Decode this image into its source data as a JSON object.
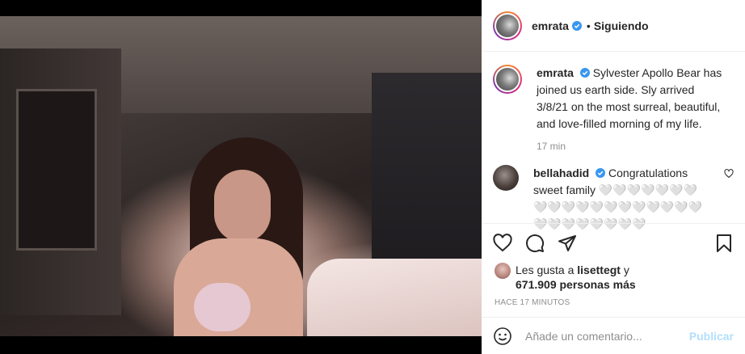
{
  "post": {
    "author": "emrata",
    "header_separator": "•",
    "follow_status": "Siguiendo"
  },
  "caption": {
    "username": "emrata",
    "text": "Sylvester Apollo Bear has joined us earth side. Sly arrived 3/8/21 on the most surreal, beautiful, and love-filled morning of my life.",
    "time": "17 min"
  },
  "comment": {
    "username": "bellahadid",
    "text": "Congratulations sweet family 🤍🤍🤍🤍🤍🤍🤍🤍🤍🤍🤍🤍🤍🤍🤍🤍🤍🤍🤍🤍🤍🤍🤍🤍🤍🤍🤍"
  },
  "likes": {
    "prefix": "Les gusta a",
    "user": "lisettegt",
    "connector": "y",
    "count": "671.909 personas más"
  },
  "posted_ago": "HACE 17 MINUTOS",
  "add_comment": {
    "placeholder": "Añade un comentario...",
    "publish_label": "Publicar"
  },
  "icons": {
    "verified": "verified-badge-icon",
    "like": "heart-icon",
    "comment": "comment-bubble-icon",
    "share": "paper-plane-icon",
    "save": "bookmark-icon",
    "emoji": "smiley-icon"
  },
  "colors": {
    "verified_blue": "#3897f0",
    "publish_disabled": "#b2dffc",
    "muted_text": "#8e8e8e"
  }
}
